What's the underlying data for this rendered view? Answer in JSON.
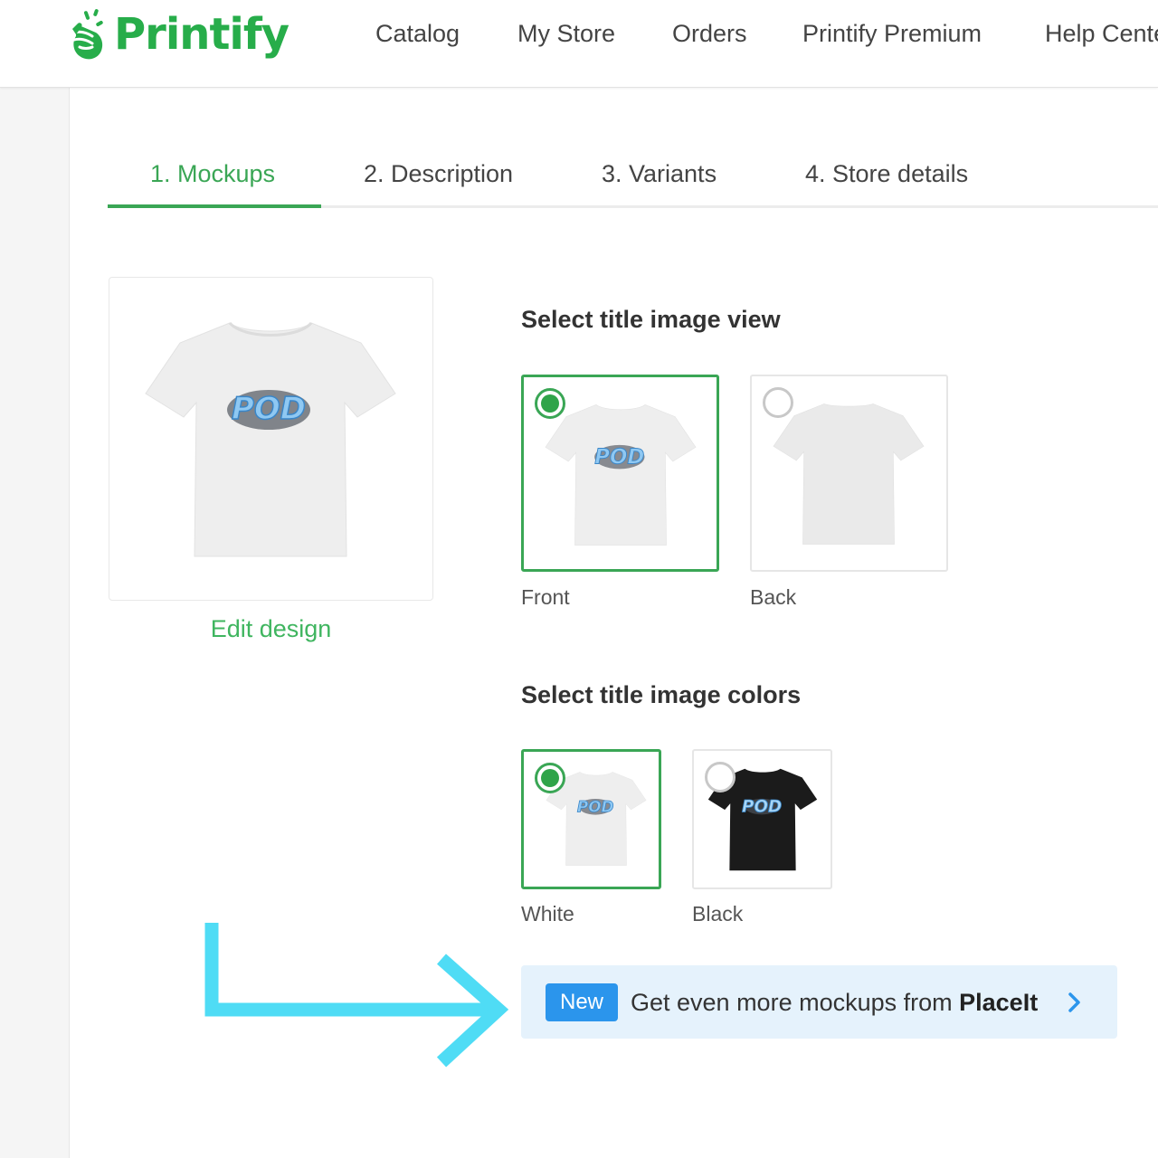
{
  "brand": {
    "name": "Printify",
    "accent": "#3aa655",
    "logo_icon": "snapping-hand-icon"
  },
  "nav": {
    "items": [
      {
        "label": "Catalog"
      },
      {
        "label": "My Store"
      },
      {
        "label": "Orders"
      },
      {
        "label": "Printify Premium"
      },
      {
        "label": "Help Cente"
      }
    ]
  },
  "steps": {
    "active_index": 0,
    "items": [
      {
        "label": "1. Mockups"
      },
      {
        "label": "2. Description"
      },
      {
        "label": "3. Variants"
      },
      {
        "label": "4. Store details"
      }
    ]
  },
  "preview": {
    "design_text": "POD",
    "shirt_color": "White",
    "edit_label": "Edit design"
  },
  "view_section": {
    "title": "Select title image view",
    "selected": "Front",
    "options": [
      {
        "label": "Front",
        "selected": true,
        "side": "front",
        "shirt_color": "#eeeeee"
      },
      {
        "label": "Back",
        "selected": false,
        "side": "back",
        "shirt_color": "#eeeeee"
      }
    ]
  },
  "color_section": {
    "title": "Select title image colors",
    "selected": "White",
    "options": [
      {
        "label": "White",
        "selected": true,
        "shirt_color": "#eeeeee"
      },
      {
        "label": "Black",
        "selected": false,
        "shirt_color": "#1b1b1b"
      }
    ]
  },
  "banner": {
    "badge": "New",
    "text": "Get even more mockups from ",
    "brand": "PlaceIt",
    "icon": "chevron-right-icon",
    "background": "#e5f2fc",
    "badge_color": "#2b95ec"
  },
  "annotation": {
    "icon": "arrow-right-icon",
    "color": "#4fdcf5"
  }
}
